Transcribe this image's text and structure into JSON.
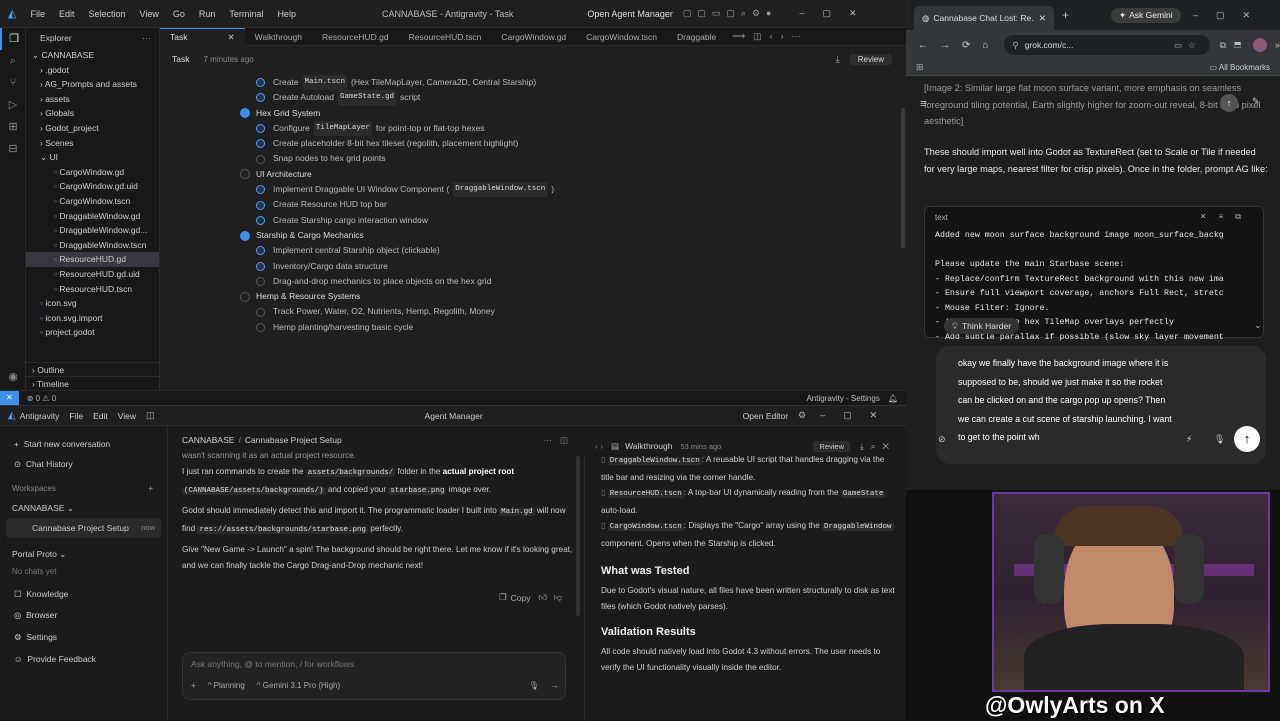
{
  "ide": {
    "menu": [
      "File",
      "Edit",
      "Selection",
      "View",
      "Go",
      "Run",
      "Terminal",
      "Help"
    ],
    "window_title": "CANNABASE - Antigravity - Task",
    "open_agent_manager": "Open Agent Manager",
    "explorer_title": "Explorer",
    "project": "CANNABASE",
    "tree": [
      {
        "name": ".godot",
        "level": 1,
        "type": "folder"
      },
      {
        "name": "AG_Prompts and assets",
        "level": 1,
        "type": "folder"
      },
      {
        "name": "assets",
        "level": 1,
        "type": "folder"
      },
      {
        "name": "Globals",
        "level": 1,
        "type": "folder"
      },
      {
        "name": "Godot_project",
        "level": 1,
        "type": "folder"
      },
      {
        "name": "Scenes",
        "level": 1,
        "type": "folder"
      },
      {
        "name": "UI",
        "level": 1,
        "type": "folder-open"
      },
      {
        "name": "CargoWindow.gd",
        "level": 2,
        "type": "file"
      },
      {
        "name": "CargoWindow.gd.uid",
        "level": 2,
        "type": "file"
      },
      {
        "name": "CargoWindow.tscn",
        "level": 2,
        "type": "file"
      },
      {
        "name": "DraggableWindow.gd",
        "level": 2,
        "type": "file"
      },
      {
        "name": "DraggableWindow.gd...",
        "level": 2,
        "type": "file"
      },
      {
        "name": "DraggableWindow.tscn",
        "level": 2,
        "type": "file"
      },
      {
        "name": "ResourceHUD.gd",
        "level": 2,
        "type": "file",
        "selected": true
      },
      {
        "name": "ResourceHUD.gd.uid",
        "level": 2,
        "type": "file"
      },
      {
        "name": "ResourceHUD.tscn",
        "level": 2,
        "type": "file"
      },
      {
        "name": "icon.svg",
        "level": 1,
        "type": "file"
      },
      {
        "name": "icon.svg.import",
        "level": 1,
        "type": "file"
      },
      {
        "name": "project.godot",
        "level": 1,
        "type": "file"
      }
    ],
    "outline": "Outline",
    "timeline": "Timeline",
    "tabs": [
      "Task",
      "Walkthrough",
      "ResourceHUD.gd",
      "ResourceHUD.tscn",
      "CargoWindow.gd",
      "CargoWindow.tscn",
      "Draggable"
    ],
    "task_header": "Task",
    "task_time": "7 minutes ago",
    "review": "Review",
    "tasks": [
      {
        "kind": "item",
        "text": "Create",
        "code": "Main.tscn",
        "after": "(Hex TileMapLayer, Camera2D, Central Starship)",
        "done": true
      },
      {
        "kind": "item",
        "text": "Create Autoload",
        "code": "GameState.gd",
        "after": "script",
        "done": true
      },
      {
        "kind": "section",
        "text": "Hex Grid System",
        "active": true
      },
      {
        "kind": "item",
        "text": "Configure",
        "code": "TileMapLayer",
        "after": "for point-top or flat-top hexes",
        "done": true
      },
      {
        "kind": "item",
        "text": "Create placeholder 8-bit hex tileset (regolith, placement highlight)",
        "done": true
      },
      {
        "kind": "item",
        "text": "Snap nodes to hex grid points",
        "done": false
      },
      {
        "kind": "section",
        "text": "UI Architecture",
        "active": false
      },
      {
        "kind": "item",
        "text": "Implement Draggable UI Window Component (",
        "code": "DraggableWindow.tscn",
        "after": ")",
        "done": true
      },
      {
        "kind": "item",
        "text": "Create Resource HUD top bar",
        "done": true
      },
      {
        "kind": "item",
        "text": "Create Starship cargo interaction window",
        "done": true
      },
      {
        "kind": "section",
        "text": "Starship & Cargo Mechanics",
        "active": true
      },
      {
        "kind": "item",
        "text": "Implement central Starship object (clickable)",
        "done": true
      },
      {
        "kind": "item",
        "text": "Inventory/Cargo data structure",
        "done": true
      },
      {
        "kind": "item",
        "text": "Drag-and-drop mechanics to place objects on the hex grid",
        "done": false
      },
      {
        "kind": "section",
        "text": "Hemp & Resource Systems",
        "active": false
      },
      {
        "kind": "item",
        "text": "Track Power, Water, O2, Nutrients, Hemp, Regolith, Money",
        "done": false
      },
      {
        "kind": "item",
        "text": "Hemp planting/harvesting basic cycle",
        "done": false
      }
    ],
    "status_left": "⊗ 0  ⚠ 0",
    "status_right": "Antigravity - Settings"
  },
  "agent": {
    "left_title": "Antigravity",
    "menu": [
      "File",
      "Edit",
      "View"
    ],
    "title": "Agent Manager",
    "open_editor": "Open Editor",
    "start": "Start new conversation",
    "history": "Chat History",
    "workspaces": "Workspaces",
    "workspace": "CANNABASE",
    "conversation": "Cannabase Project Setup",
    "conversation_time": "now",
    "portal": "Portal Proto",
    "no_chats": "No chats yet",
    "bottom": [
      "Knowledge",
      "Browser",
      "Settings",
      "Provide Feedback"
    ],
    "breadcrumb_ws": "CANNABASE",
    "breadcrumb_conv": "Cannabase Project Setup",
    "chat_partial": "wasn't scanning it as an actual project resource.",
    "chat_p1_a": "I just ran commands to create the",
    "chat_p1_code1": "assets/backgrounds/",
    "chat_p1_b": "folder in the",
    "chat_p1_bold": "actual project root",
    "chat_p1_code2": "(CANNABASE/assets/backgrounds/)",
    "chat_p1_c": "and copied your",
    "chat_p1_code3": "starbase.png",
    "chat_p1_d": "image over.",
    "chat_p2_a": "Godot should immediately detect this and import it. The programmatic loader I built into",
    "chat_p2_code1": "Main.gd",
    "chat_p2_b": "will now find",
    "chat_p2_code2": "res://assets/backgrounds/starbase.png",
    "chat_p2_c": "perfectly.",
    "chat_p3": "Give \"New Game -> Launch\" a spin! The background should be right there. Let me know if it's looking great, and we can finally tackle the Cargo Drag-and-Drop mechanic next!",
    "copy": "Copy",
    "input_placeholder": "Ask anything, @ to mention, / for workflows",
    "mode": "Planning",
    "model": "Gemini 3.1 Pro (High)",
    "walk_title": "Walkthrough",
    "walk_time": "53 mins ago",
    "walk_review": "Review",
    "walk_items": [
      {
        "code": "DraggableWindow.tscn",
        "text": ": A reusable UI script that handles dragging via the title bar and resizing via the corner handle."
      },
      {
        "code": "ResourceHUD.tscn",
        "text": ": A top-bar UI dynamically reading from the",
        "code2": "GameState",
        "text2": "auto-load."
      },
      {
        "code": "CargoWindow.tscn",
        "text": ": Displays the \"Cargo\" array using the",
        "code2": "DraggableWindow",
        "text2": "component. Opens when the Starship is clicked."
      }
    ],
    "tested_h": "What was Tested",
    "tested_p": "Due to Godot's visual nature, all files have been written structurally to disk as text files (which Godot natively parses).",
    "validation_h": "Validation Results",
    "validation_p": "All code should natively load into Godot 4.3 without errors. The user needs to verify the UI functionality visually inside the editor."
  },
  "browser": {
    "tab_title": "Cannabase Chat Lost: Re...",
    "ask_gemini": "Ask Gemini",
    "url": "grok.com/c...",
    "bookmarks": "All Bookmarks",
    "top_faded": "[Image 2: Similar large flat moon surface variant, more emphasis on seamless foreground tiling potential, Earth slightly higher for zoom-out reveal, 8-bit retro pixel aesthetic]",
    "para": "These should import well into Godot as TextureRect (set to Scale or Tile if needed for very large maps, nearest filter for crisp pixels). Once in the folder, prompt AG like:",
    "code_label": "text",
    "code_lines": [
      "Added new moon surface background image moon_surface_backg",
      "",
      "Please update the main Starbase scene:",
      "- Replace/confirm TextureRect background with this new ima",
      "- Ensure full viewport coverage, anchors Full Rect, stretc",
      "- Mouse Filter: Ignore.",
      "- Align bottom so hex TileMap overlays perfectly",
      "- Add subtle parallax if possible (slow sky layer movement"
    ],
    "think_harder": "Think Harder",
    "input_text": "okay we finally have the background image where it is supposed to be, should we just make it so the rocket can be clicked on and the cargo pop up opens? Then we can create a cut scene of starship launching. I want to get to the point wh"
  },
  "webcam": {
    "handle": "@OwlyArts on X"
  },
  "colors": {
    "accent": "#3b8eea",
    "bg": "#1f1f1f",
    "browser_bg": "#1e1e1e"
  }
}
